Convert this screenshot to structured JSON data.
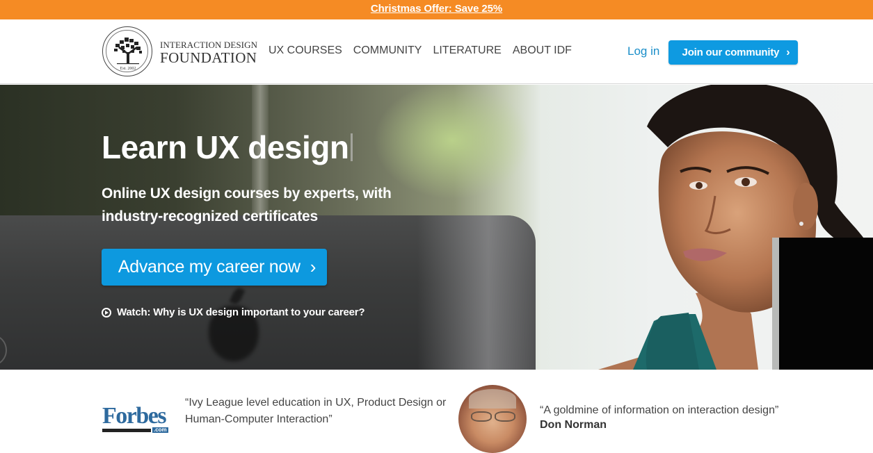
{
  "promo": {
    "text": "Christmas Offer: Save 25%"
  },
  "brand": {
    "seal_text": "Est. 2002",
    "name_line1": "INTERACTION DESIGN",
    "name_line2": "FOUNDATION"
  },
  "nav": {
    "items": [
      {
        "label": "UX COURSES"
      },
      {
        "label": "COMMUNITY"
      },
      {
        "label": "LITERATURE"
      },
      {
        "label": "ABOUT IDF"
      }
    ],
    "login": "Log in",
    "join": "Join our community",
    "join_icon": "chevron-right-icon"
  },
  "hero": {
    "title": "Learn UX design",
    "subtitle": "Online UX design courses by experts, with industry-recognized certificates",
    "cta": "Advance my career now",
    "cta_icon": "chevron-right-icon",
    "watch": "Watch: Why is UX design important to your career?",
    "watch_icon": "play-circle-icon"
  },
  "testimonials": [
    {
      "source": "Forbes",
      "source_suffix": ".com",
      "quote": "“Ivy League level education in UX, Product Design or Human-Computer Interaction”"
    },
    {
      "quote": "“A goldmine of information on interaction design”",
      "author": "Don Norman"
    }
  ],
  "colors": {
    "promo": "#f58b24",
    "accent": "#0e9ae1",
    "link": "#1a8ec9",
    "forbes": "#2e6a9e"
  }
}
